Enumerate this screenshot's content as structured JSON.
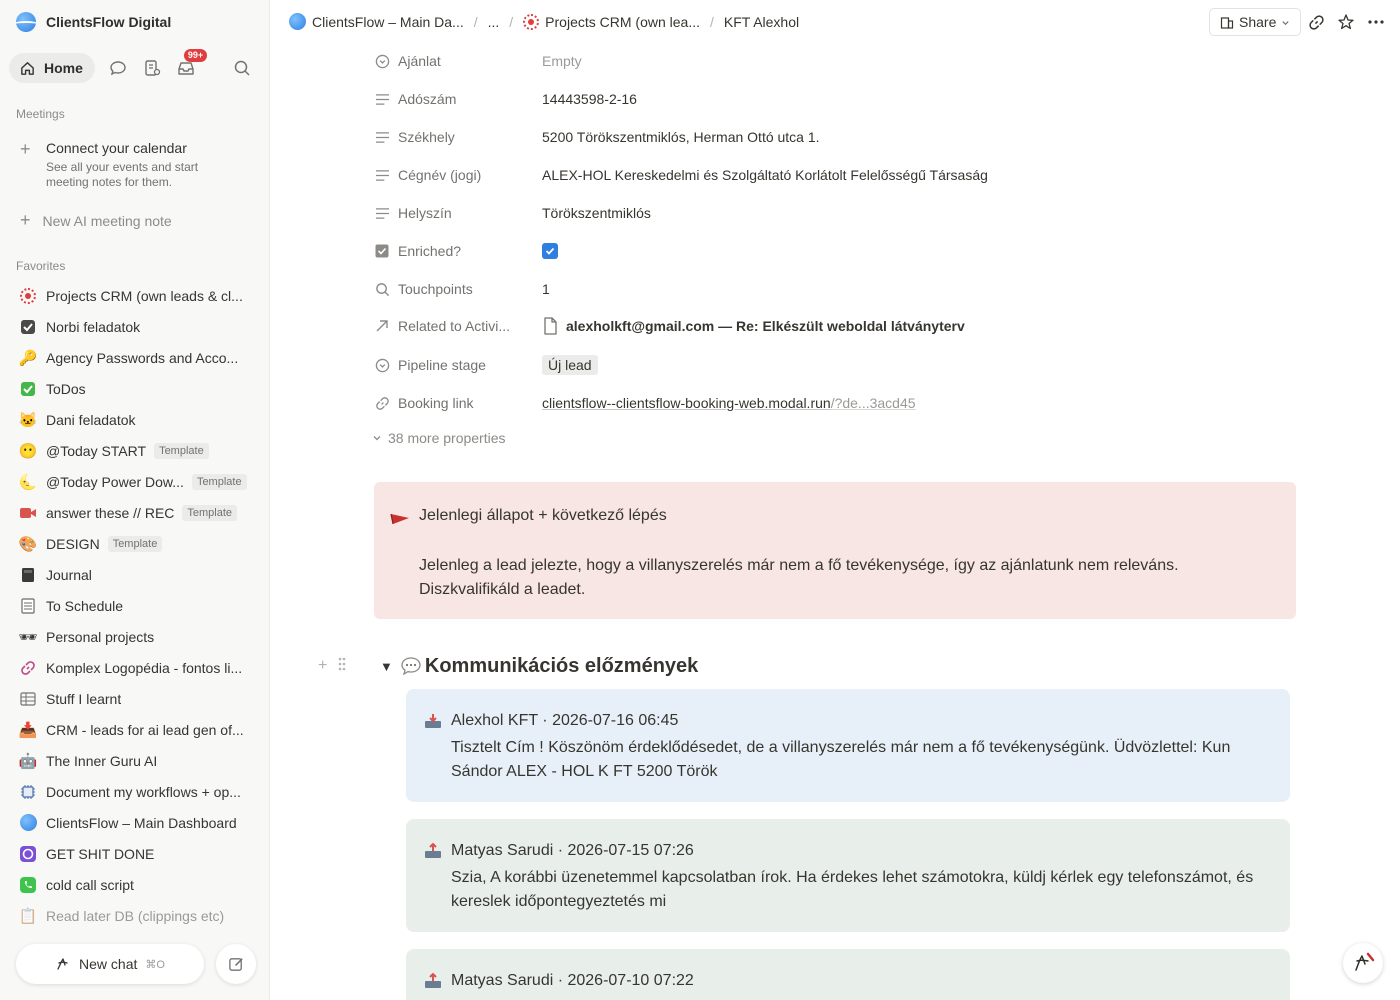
{
  "workspace": {
    "name": "ClientsFlow Digital"
  },
  "nav": {
    "home_label": "Home",
    "inbox_badge": "99+"
  },
  "meetings": {
    "section_label": "Meetings",
    "connect_title": "Connect your calendar",
    "connect_desc": "See all your events and start meeting notes for them.",
    "new_note": "New AI meeting note"
  },
  "favorites": {
    "section_label": "Favorites",
    "items": [
      {
        "label": "Projects CRM (own leads & cl...",
        "icon": "crm-dotted-icon"
      },
      {
        "label": "Norbi feladatok",
        "icon": "checkbox-icon"
      },
      {
        "label": "Agency Passwords and Acco...",
        "icon": "key-icon"
      },
      {
        "label": "ToDos",
        "icon": "check-mark-icon"
      },
      {
        "label": "Dani feladatok",
        "icon": "cat-icon"
      },
      {
        "label": "@Today START",
        "icon": "smile-icon",
        "tag": "Template"
      },
      {
        "label": "@Today Power Dow...",
        "icon": "moon-icon",
        "tag": "Template"
      },
      {
        "label": "answer these // REC",
        "icon": "video-camera-icon",
        "tag": "Template"
      },
      {
        "label": "DESIGN",
        "icon": "palette-icon",
        "tag": "Template"
      },
      {
        "label": "Journal",
        "icon": "notebook-icon"
      },
      {
        "label": "To Schedule",
        "icon": "ledger-icon"
      },
      {
        "label": "Personal projects",
        "icon": "sunglasses-icon"
      },
      {
        "label": "Komplex Logopédia - fontos li...",
        "icon": "link-icon"
      },
      {
        "label": "Stuff I learnt",
        "icon": "table-icon"
      },
      {
        "label": "CRM - leads for ai lead gen of...",
        "icon": "inbox-tray-icon"
      },
      {
        "label": "The Inner Guru AI",
        "icon": "robot-icon"
      },
      {
        "label": "Document my workflows + op...",
        "icon": "chip-icon"
      },
      {
        "label": "ClientsFlow – Main Dashboard",
        "icon": "clientsflow-logo-icon"
      },
      {
        "label": "GET SHIT DONE",
        "icon": "purple-circle-icon"
      },
      {
        "label": "cold call script",
        "icon": "phone-icon"
      },
      {
        "label": "Read later DB (clippings etc)",
        "icon": "clipboard-icon"
      }
    ]
  },
  "bottom": {
    "new_chat": "New chat",
    "shortcut": "⌘O"
  },
  "breadcrumb": {
    "c1": "ClientsFlow – Main Da...",
    "c2": "...",
    "c3": "Projects CRM (own lea...",
    "c4": "KFT Alexhol"
  },
  "topbar": {
    "share": "Share"
  },
  "properties": [
    {
      "name": "Ajánlat",
      "value": "Empty",
      "icon": "status-circle-icon"
    },
    {
      "name": "Adószám",
      "value": "14443598-2-16",
      "icon": "text-lines-icon"
    },
    {
      "name": "Székhely",
      "value": "5200 Törökszentmiklós, Herman Ottó utca 1.",
      "icon": "text-lines-icon"
    },
    {
      "name": "Cégnév (jogi)",
      "value": "ALEX-HOL Kereskedelmi és Szolgáltató Korlátolt Felelősségű Társaság",
      "icon": "text-lines-icon"
    },
    {
      "name": "Helyszín",
      "value": "Törökszentmiklós",
      "icon": "text-lines-icon"
    },
    {
      "name": "Enriched?",
      "value": "",
      "icon": "checkbox-icon"
    },
    {
      "name": "Touchpoints",
      "value": "1",
      "icon": "search-icon"
    },
    {
      "name": "Related to Activi...",
      "value": "alexholkft@gmail.com — Re: Elkészült weboldal látványterv",
      "icon": "arrow-up-right-icon"
    },
    {
      "name": "Pipeline stage",
      "value": "Új lead",
      "icon": "status-circle-icon"
    },
    {
      "name": "Booking link",
      "value": "clientsflow--clientsflow-booking-web.modal.run",
      "value_rest": "/?de...3acd45",
      "icon": "link-icon"
    }
  ],
  "more_properties": "38 more properties",
  "callout": {
    "title": "Jelenlegi állapot + következő lépés",
    "body": "Jelenleg a lead jelezte, hogy a villanyszerelés már nem a fő tevékenysége, így az ajánlatunk nem releváns. Diszkvalifikáld a leadet."
  },
  "comm_heading": "Kommunikációs előzmények",
  "messages": [
    {
      "header": "Alexhol KFT · 2026-07-16 06:45",
      "body": "Tisztelt Cím ! Köszönöm érdeklődésedet, de a villanyszerelés már nem a fő tevékenységünk. Üdvözlettel: Kun Sándor ALEX - HOL K FT 5200 Török"
    },
    {
      "header": "Matyas Sarudi · 2026-07-15 07:26",
      "body": "Szia, A korábbi üzenetemmel kapcsolatban írok. Ha érdekes lehet számotokra, küldj kérlek egy telefonszámot, és kereslek időpontegyeztetés mi"
    },
    {
      "header": "Matyas Sarudi · 2026-07-10 07:22",
      "body": ""
    }
  ]
}
